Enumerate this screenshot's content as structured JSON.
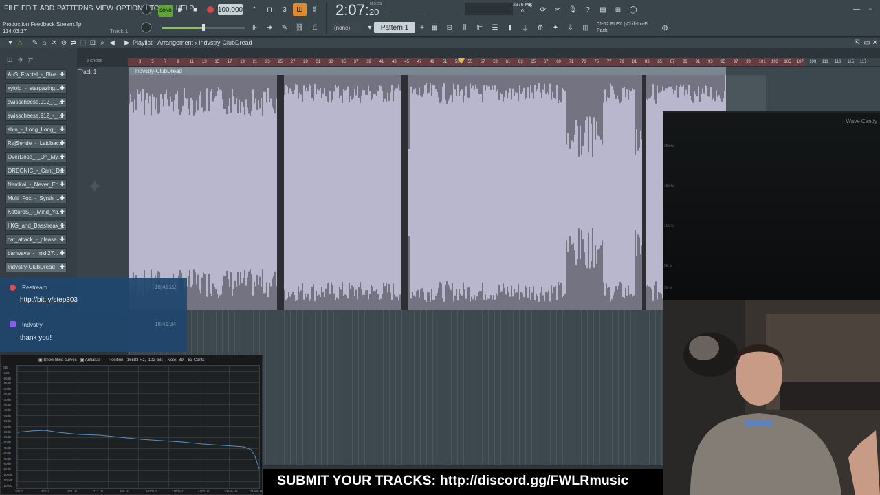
{
  "menu": [
    "FILE",
    "EDIT",
    "ADD",
    "PATTERNS",
    "VIEW",
    "OPTIONS",
    "TOOLS",
    "HELP"
  ],
  "project": {
    "name": "Production Feedback Stream.flp",
    "position": "114:03:17",
    "track_hint": "Track 1"
  },
  "transport": {
    "mode": "SONG",
    "tempo": "100.000",
    "time_main": "2:07",
    "time_sub": "20",
    "time_label": "M:S:CS"
  },
  "cpu": {
    "voices": "6",
    "ram": "2376 MB",
    "zero": "0"
  },
  "pattern": {
    "selected": "Pattern 1",
    "none_label": "(none)"
  },
  "hint": {
    "line1": "01-12 FLEX | Chill-Lo-Fi",
    "line2": "Pack"
  },
  "playlist": {
    "title": "Playlist - Arrangement › Indvstry-ClubDread",
    "track_name": "Track 1",
    "clip_name": "Indvstry-ClubDread",
    "toolbar_label": "ℤ CROSS"
  },
  "patterns": [
    "AuS_Fractal_-_Blue...",
    "xyloid_-_stargazing...",
    "swisscheese.912_-_I...",
    "swisscheese.912_-_I...",
    "shin_-_Long_Long_...",
    "RejSende_-_Laidbac...",
    "OverDose_-_On_My...",
    "OREONIC_-_Cant_Do...",
    "Nemkai_-_Never_En...",
    "Multi_Fox_-_Synth_...",
    "KotturbS_-_Mind_Yo...",
    "IIKG_and_Bassfreak_...",
    "cat_attack_-_please...",
    "banwave_-_midi27...",
    "Indvstry-ClubDread"
  ],
  "ruler_numbers": [
    "3",
    "5",
    "7",
    "9",
    "11",
    "13",
    "15",
    "17",
    "19",
    "21",
    "23",
    "25",
    "27",
    "29",
    "31",
    "33",
    "35",
    "37",
    "39",
    "41",
    "43",
    "45",
    "47",
    "49",
    "51",
    "53",
    "55",
    "57",
    "59",
    "61",
    "63",
    "65",
    "67",
    "69",
    "71",
    "73",
    "75",
    "77",
    "79",
    "81",
    "83",
    "85",
    "87",
    "89",
    "91",
    "93",
    "95",
    "97",
    "99",
    "101",
    "103",
    "105",
    "107",
    "109",
    "111",
    "113",
    "115",
    "117"
  ],
  "wave_candy": {
    "title": "Wave Candy",
    "ticks": [
      "20kHz",
      "15kHz",
      "10kHz",
      "5kHz",
      "2kHz"
    ]
  },
  "chat": {
    "messages": [
      {
        "user": "Restream",
        "time": "18:41:22",
        "text": "http://bit.ly/step303",
        "color": "#e04a4a"
      },
      {
        "user": "Indvstry",
        "time": "18:41:34",
        "text": "thank you!",
        "color": "#8a5cf0"
      }
    ]
  },
  "spectrum": {
    "show_filled": "Show filled curves",
    "antialias": "Antialias",
    "position": "Position: (16583 Hz, -102 dB)",
    "note": "Note: B9",
    "cents": "83 Cents",
    "ylabels": [
      "0dB",
      "-5dB",
      "-10dB",
      "-15dB",
      "-20dB",
      "-25dB",
      "-30dB",
      "-35dB",
      "-40dB",
      "-45dB",
      "-50dB",
      "-55dB",
      "-60dB",
      "-65dB",
      "-70dB",
      "-75dB",
      "-80dB",
      "-85dB",
      "-90dB",
      "-95dB",
      "-100dB",
      "-105dB",
      "-110dB"
    ],
    "xlabels": [
      "20 Hz",
      "47 Hz",
      "101 Hz",
      "217 Hz",
      "469 Hz",
      "1010 Hz",
      "2180 Hz",
      "4700 Hz",
      "10160 Hz",
      "21900 Hz"
    ]
  },
  "banner": {
    "text": "SUBMIT YOUR TRACKS: http://discord.gg/FWLRmusic"
  },
  "colors": {
    "accent_green": "#5ea63a",
    "waveform": "#b9b7cd",
    "chat_bg": "#1f466e",
    "ruler_red": "#6b3a3f"
  }
}
